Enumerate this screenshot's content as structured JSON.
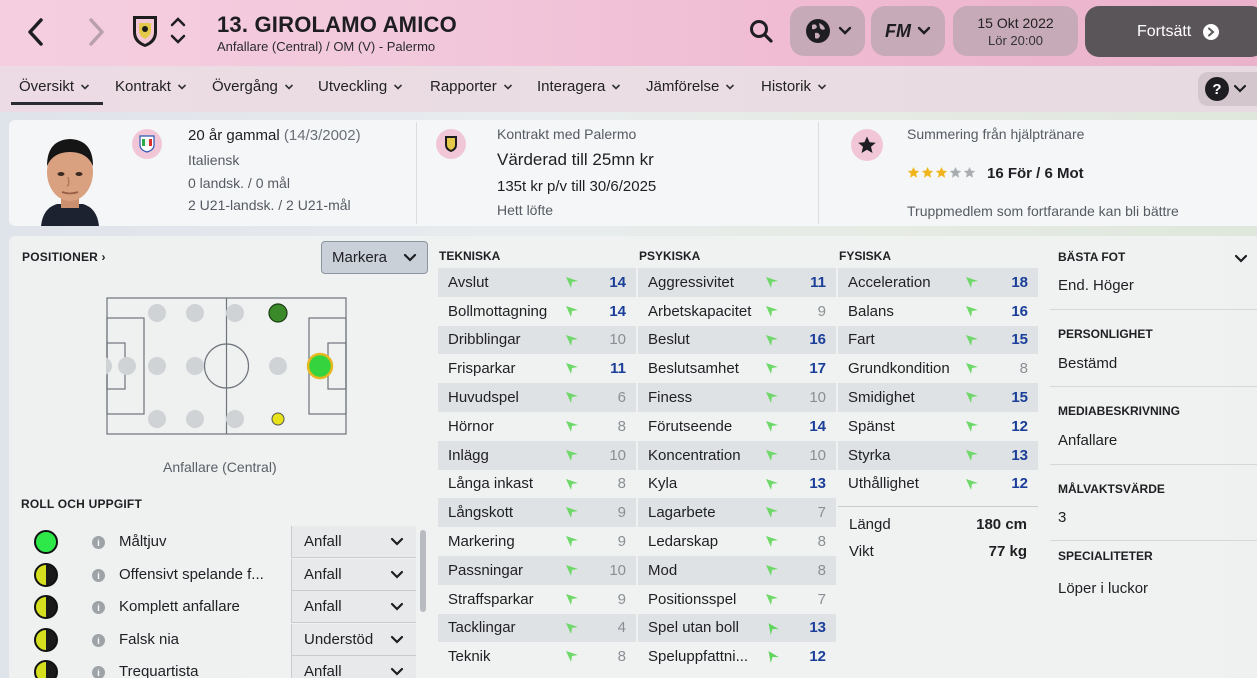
{
  "header": {
    "player_title": "13. GIROLAMO AMICO",
    "player_subtitle": "Anfallare (Central) / OM (V) - Palermo",
    "date_main": "15 Okt 2022",
    "date_sub": "Lör 20:00",
    "continue_label": "Fortsätt",
    "fm_label": "FM"
  },
  "tabs": [
    {
      "label": "Översikt"
    },
    {
      "label": "Kontrakt"
    },
    {
      "label": "Övergång"
    },
    {
      "label": "Utveckling"
    },
    {
      "label": "Rapporter"
    },
    {
      "label": "Interagera"
    },
    {
      "label": "Jämförelse"
    },
    {
      "label": "Historik"
    }
  ],
  "info": {
    "age": "20 år gammal",
    "dob": "(14/3/2002)",
    "nationality": "Italiensk",
    "caps": "0 landsk. / 0 mål",
    "u21_caps": "2 U21-landsk. / 2 U21-mål",
    "contract_label": "Kontrakt med Palermo",
    "value": "Värderad till 25mn kr",
    "wage": "135t kr p/v till 30/6/2025",
    "prospect": "Hett löfte",
    "assistant_label": "Summering från hjälptränare",
    "star_rating": 3,
    "star_max": 5,
    "for_against": "16 För / 6 Mot",
    "assistant_note": "Truppmedlem som fortfarande kan bli bättre"
  },
  "positions": {
    "section_label": "POSITIONER",
    "highlight_select": "Markera",
    "caption": "Anfallare (Central)"
  },
  "roles": {
    "section_label": "ROLL OCH UPPGIFT",
    "items": [
      {
        "name": "Måltjuv",
        "duty": "Anfall",
        "rating": "full",
        "color": "#2ee84a"
      },
      {
        "name": "Offensivt spelande f...",
        "duty": "Anfall",
        "rating": "half",
        "color": "#d6df1f"
      },
      {
        "name": "Komplett anfallare",
        "duty": "Anfall",
        "rating": "half",
        "color": "#d6df1f"
      },
      {
        "name": "Falsk nia",
        "duty": "Understöd",
        "rating": "half",
        "color": "#d6df1f"
      },
      {
        "name": "Trequartista",
        "duty": "Anfall",
        "rating": "half",
        "color": "#d6df1f"
      }
    ]
  },
  "attributes": {
    "technical": {
      "label": "TEKNISKA",
      "rows": [
        {
          "name": "Avslut",
          "value": "14",
          "hl": true
        },
        {
          "name": "Bollmottagning",
          "value": "14",
          "hl": true
        },
        {
          "name": "Dribblingar",
          "value": "10",
          "hl": false
        },
        {
          "name": "Frisparkar",
          "value": "11",
          "hl": true
        },
        {
          "name": "Huvudspel",
          "value": "6",
          "hl": false
        },
        {
          "name": "Hörnor",
          "value": "8",
          "hl": false
        },
        {
          "name": "Inlägg",
          "value": "10",
          "hl": false
        },
        {
          "name": "Långa inkast",
          "value": "8",
          "hl": false
        },
        {
          "name": "Långskott",
          "value": "9",
          "hl": false
        },
        {
          "name": "Markering",
          "value": "9",
          "hl": false
        },
        {
          "name": "Passningar",
          "value": "10",
          "hl": false
        },
        {
          "name": "Straffsparkar",
          "value": "9",
          "hl": false
        },
        {
          "name": "Tacklingar",
          "value": "4",
          "hl": false
        },
        {
          "name": "Teknik",
          "value": "8",
          "hl": false
        }
      ]
    },
    "mental": {
      "label": "PSYKISKA",
      "rows": [
        {
          "name": "Aggressivitet",
          "value": "11",
          "hl": true
        },
        {
          "name": "Arbetskapacitet",
          "value": "9",
          "hl": false
        },
        {
          "name": "Beslut",
          "value": "16",
          "hl": true
        },
        {
          "name": "Beslutsamhet",
          "value": "17",
          "hl": true
        },
        {
          "name": "Finess",
          "value": "10",
          "hl": false
        },
        {
          "name": "Förutseende",
          "value": "14",
          "hl": true
        },
        {
          "name": "Koncentration",
          "value": "10",
          "hl": false
        },
        {
          "name": "Kyla",
          "value": "13",
          "hl": true
        },
        {
          "name": "Lagarbete",
          "value": "7",
          "hl": false
        },
        {
          "name": "Ledarskap",
          "value": "8",
          "hl": false
        },
        {
          "name": "Mod",
          "value": "8",
          "hl": false
        },
        {
          "name": "Positionsspel",
          "value": "7",
          "hl": false
        },
        {
          "name": "Spel utan boll",
          "value": "13",
          "hl": true
        },
        {
          "name": "Speluppfattni...",
          "value": "12",
          "hl": true
        }
      ]
    },
    "physical": {
      "label": "FYSISKA",
      "rows": [
        {
          "name": "Acceleration",
          "value": "18",
          "hl": true
        },
        {
          "name": "Balans",
          "value": "16",
          "hl": true
        },
        {
          "name": "Fart",
          "value": "15",
          "hl": true
        },
        {
          "name": "Grundkondition",
          "value": "8",
          "hl": false
        },
        {
          "name": "Smidighet",
          "value": "15",
          "hl": true
        },
        {
          "name": "Spänst",
          "value": "12",
          "hl": true
        },
        {
          "name": "Styrka",
          "value": "13",
          "hl": true
        },
        {
          "name": "Uthållighet",
          "value": "12",
          "hl": true
        }
      ],
      "height_label": "Längd",
      "height_value": "180 cm",
      "weight_label": "Vikt",
      "weight_value": "77 kg"
    }
  },
  "side": {
    "foot_label": "BÄSTA FOT",
    "foot_value": "End. Höger",
    "personality_label": "PERSONLIGHET",
    "personality_value": "Bestämd",
    "media_label": "MEDIABESKRIVNING",
    "media_value": "Anfallare",
    "gk_label": "MÅLVAKTSVÄRDE",
    "gk_value": "3",
    "spec_label": "SPECIALITETER",
    "spec_value": "Löper i luckor"
  },
  "colors": {
    "accent_pink": "#efbcd3",
    "value_blue": "#1b3f99",
    "arrow_green": "#5fd45a",
    "primary_position": "#35d43f",
    "secondary_position": "#3a8a2a"
  },
  "icons": [
    "back-arrow-icon",
    "forward-arrow-icon",
    "palermo-badge-icon",
    "search-icon",
    "globe-icon",
    "fm-icon",
    "help-icon",
    "star-icon",
    "italy-flag-icon",
    "info-icon"
  ]
}
